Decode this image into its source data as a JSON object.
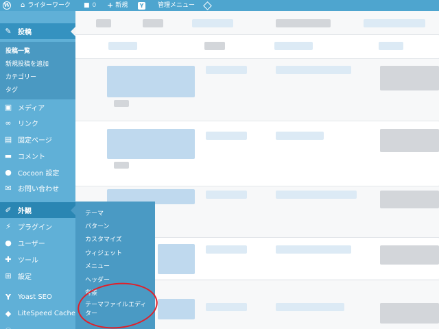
{
  "adminbar": {
    "site_name": "ライターワーク",
    "comment_count": "0",
    "new_label": "新規",
    "manage_label": "管理メニュー"
  },
  "sidebar": {
    "posts": {
      "label": "投稿",
      "submenu": [
        "投稿一覧",
        "新規投稿を追加",
        "カテゴリー",
        "タグ"
      ]
    },
    "items": [
      "メディア",
      "リンク",
      "固定ページ",
      "コメント",
      "Cocoon 設定",
      "お問い合わせ"
    ],
    "appearance": "外観",
    "items2": [
      "プラグイン",
      "ユーザー",
      "ツール",
      "設定"
    ],
    "items3": [
      "Yoast SEO",
      "LiteSpeed Cache"
    ]
  },
  "flyout": {
    "items": [
      "テーマ",
      "パターン",
      "カスタマイズ",
      "ウィジェット",
      "メニュー",
      "ヘッダー",
      "背景"
    ],
    "editor_line1": "テーマファイルエディ",
    "editor_line2": "ター"
  },
  "colors": {
    "adminbar": "#4ea5cf",
    "sidebar": "#60b0d7",
    "highlight_oval": "#e0202a"
  }
}
